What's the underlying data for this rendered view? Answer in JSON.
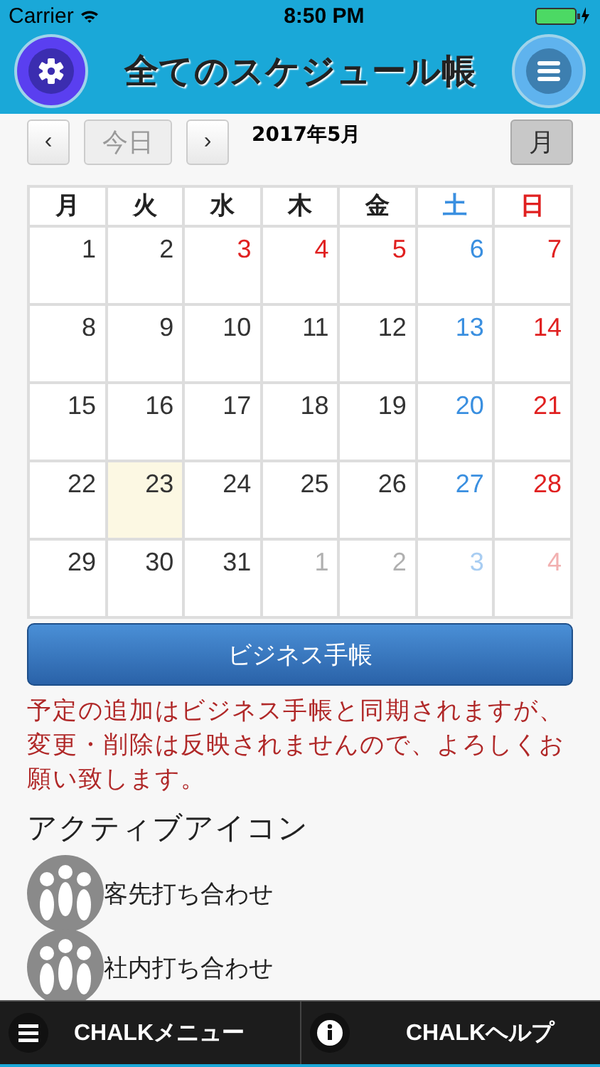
{
  "status_bar": {
    "carrier": "Carrier",
    "time": "8:50 PM"
  },
  "header": {
    "title": "全てのスケジュール帳"
  },
  "toolbar": {
    "prev": "‹",
    "today": "今日",
    "next": "›",
    "month_title": "2017年5月",
    "view": "月",
    "view_selected": true
  },
  "calendar": {
    "weekdays": [
      {
        "label": "月",
        "color": "#222222"
      },
      {
        "label": "火",
        "color": "#222222"
      },
      {
        "label": "水",
        "color": "#222222"
      },
      {
        "label": "木",
        "color": "#222222"
      },
      {
        "label": "金",
        "color": "#222222"
      },
      {
        "label": "土",
        "color": "#3a8fe0"
      },
      {
        "label": "日",
        "color": "#e02020"
      }
    ],
    "weeks": [
      [
        {
          "day": "1",
          "color": "#333333",
          "selected": false
        },
        {
          "day": "2",
          "color": "#333333",
          "selected": false
        },
        {
          "day": "3",
          "color": "#e02020",
          "selected": false
        },
        {
          "day": "4",
          "color": "#e02020",
          "selected": false
        },
        {
          "day": "5",
          "color": "#e02020",
          "selected": false
        },
        {
          "day": "6",
          "color": "#3a8fe0",
          "selected": false
        },
        {
          "day": "7",
          "color": "#e02020",
          "selected": false
        }
      ],
      [
        {
          "day": "8",
          "color": "#333333",
          "selected": false
        },
        {
          "day": "9",
          "color": "#333333",
          "selected": false
        },
        {
          "day": "10",
          "color": "#333333",
          "selected": false
        },
        {
          "day": "11",
          "color": "#333333",
          "selected": false
        },
        {
          "day": "12",
          "color": "#333333",
          "selected": false
        },
        {
          "day": "13",
          "color": "#3a8fe0",
          "selected": false
        },
        {
          "day": "14",
          "color": "#e02020",
          "selected": false
        }
      ],
      [
        {
          "day": "15",
          "color": "#333333",
          "selected": false
        },
        {
          "day": "16",
          "color": "#333333",
          "selected": false
        },
        {
          "day": "17",
          "color": "#333333",
          "selected": false
        },
        {
          "day": "18",
          "color": "#333333",
          "selected": false
        },
        {
          "day": "19",
          "color": "#333333",
          "selected": false
        },
        {
          "day": "20",
          "color": "#3a8fe0",
          "selected": false
        },
        {
          "day": "21",
          "color": "#e02020",
          "selected": false
        }
      ],
      [
        {
          "day": "22",
          "color": "#333333",
          "selected": false
        },
        {
          "day": "23",
          "color": "#333333",
          "selected": true
        },
        {
          "day": "24",
          "color": "#333333",
          "selected": false
        },
        {
          "day": "25",
          "color": "#333333",
          "selected": false
        },
        {
          "day": "26",
          "color": "#333333",
          "selected": false
        },
        {
          "day": "27",
          "color": "#3a8fe0",
          "selected": false
        },
        {
          "day": "28",
          "color": "#e02020",
          "selected": false
        }
      ],
      [
        {
          "day": "29",
          "color": "#333333",
          "selected": false
        },
        {
          "day": "30",
          "color": "#333333",
          "selected": false
        },
        {
          "day": "31",
          "color": "#333333",
          "selected": false
        },
        {
          "day": "1",
          "color": "#b0b0b0",
          "selected": false
        },
        {
          "day": "2",
          "color": "#b0b0b0",
          "selected": false
        },
        {
          "day": "3",
          "color": "#a8cdf2",
          "selected": false
        },
        {
          "day": "4",
          "color": "#f2b0b0",
          "selected": false
        }
      ]
    ]
  },
  "business_button": "ビジネス手帳",
  "notice": "予定の追加はビジネス手帳と同期されますが、変更・削除は反映されませんので、よろしくお願い致します。",
  "active_icons": {
    "heading": "アクティブアイコン",
    "items": [
      {
        "label": "客先打ち合わせ"
      },
      {
        "label": "社内打ち合わせ"
      }
    ]
  },
  "bottom_bar": {
    "menu": "CHALKメニュー",
    "help": "CHALKヘルプ"
  }
}
